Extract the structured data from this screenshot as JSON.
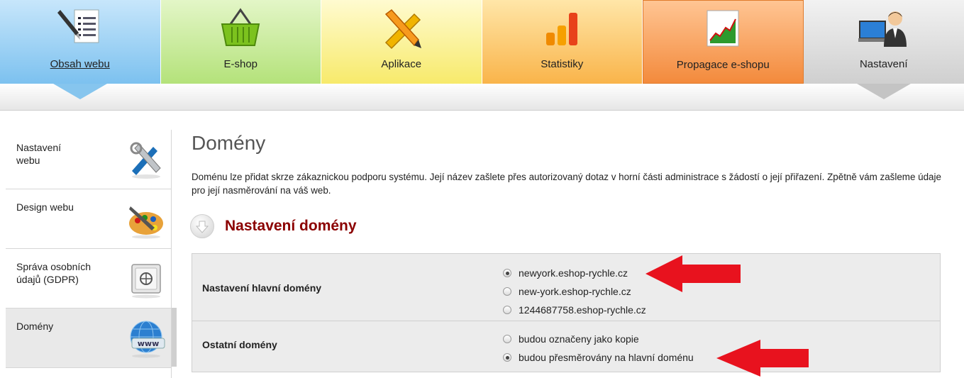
{
  "topnav": {
    "tabs": [
      {
        "label": "Obsah webu",
        "icon": "document-pen-icon",
        "active": true
      },
      {
        "label": "E-shop",
        "icon": "basket-icon"
      },
      {
        "label": "Aplikace",
        "icon": "pencil-ruler-icon"
      },
      {
        "label": "Statistiky",
        "icon": "bar-chart-icon"
      },
      {
        "label": "Propagace e-shopu",
        "icon": "line-chart-icon"
      },
      {
        "label": "Nastavení",
        "icon": "user-computer-icon"
      }
    ]
  },
  "sidebar": {
    "items": [
      {
        "label": "Nastavení\nwebu",
        "icon": "tools-icon"
      },
      {
        "label": "Design webu",
        "icon": "palette-icon"
      },
      {
        "label": "Správa osobních údajů (GDPR)",
        "icon": "safe-icon"
      },
      {
        "label": "Domény",
        "icon": "globe-www-icon",
        "active": true
      }
    ]
  },
  "main": {
    "title": "Domény",
    "description": "Doménu lze přidat skrze zákaznickou podporu systému. Její název zašlete přes autorizovaný dotaz v horní části administrace s žádostí o její přiřazení. Zpětně vám zašleme údaje pro její nasměrování na váš web.",
    "section_title": "Nastavení domény",
    "rows": [
      {
        "label": "Nastavení hlavní domény",
        "options": [
          "newyork.eshop-rychle.cz",
          "new-york.eshop-rychle.cz",
          "1244687758.eshop-rychle.cz"
        ],
        "selected": 0
      },
      {
        "label": "Ostatní domény",
        "options": [
          "budou označeny jako kopie",
          "budou přesměrovány na hlavní doménu"
        ],
        "selected": 1
      }
    ]
  },
  "colors": {
    "section_title": "#8b0000",
    "annotation_arrow": "#e8121e",
    "tab_active": "#7cc1ef"
  }
}
